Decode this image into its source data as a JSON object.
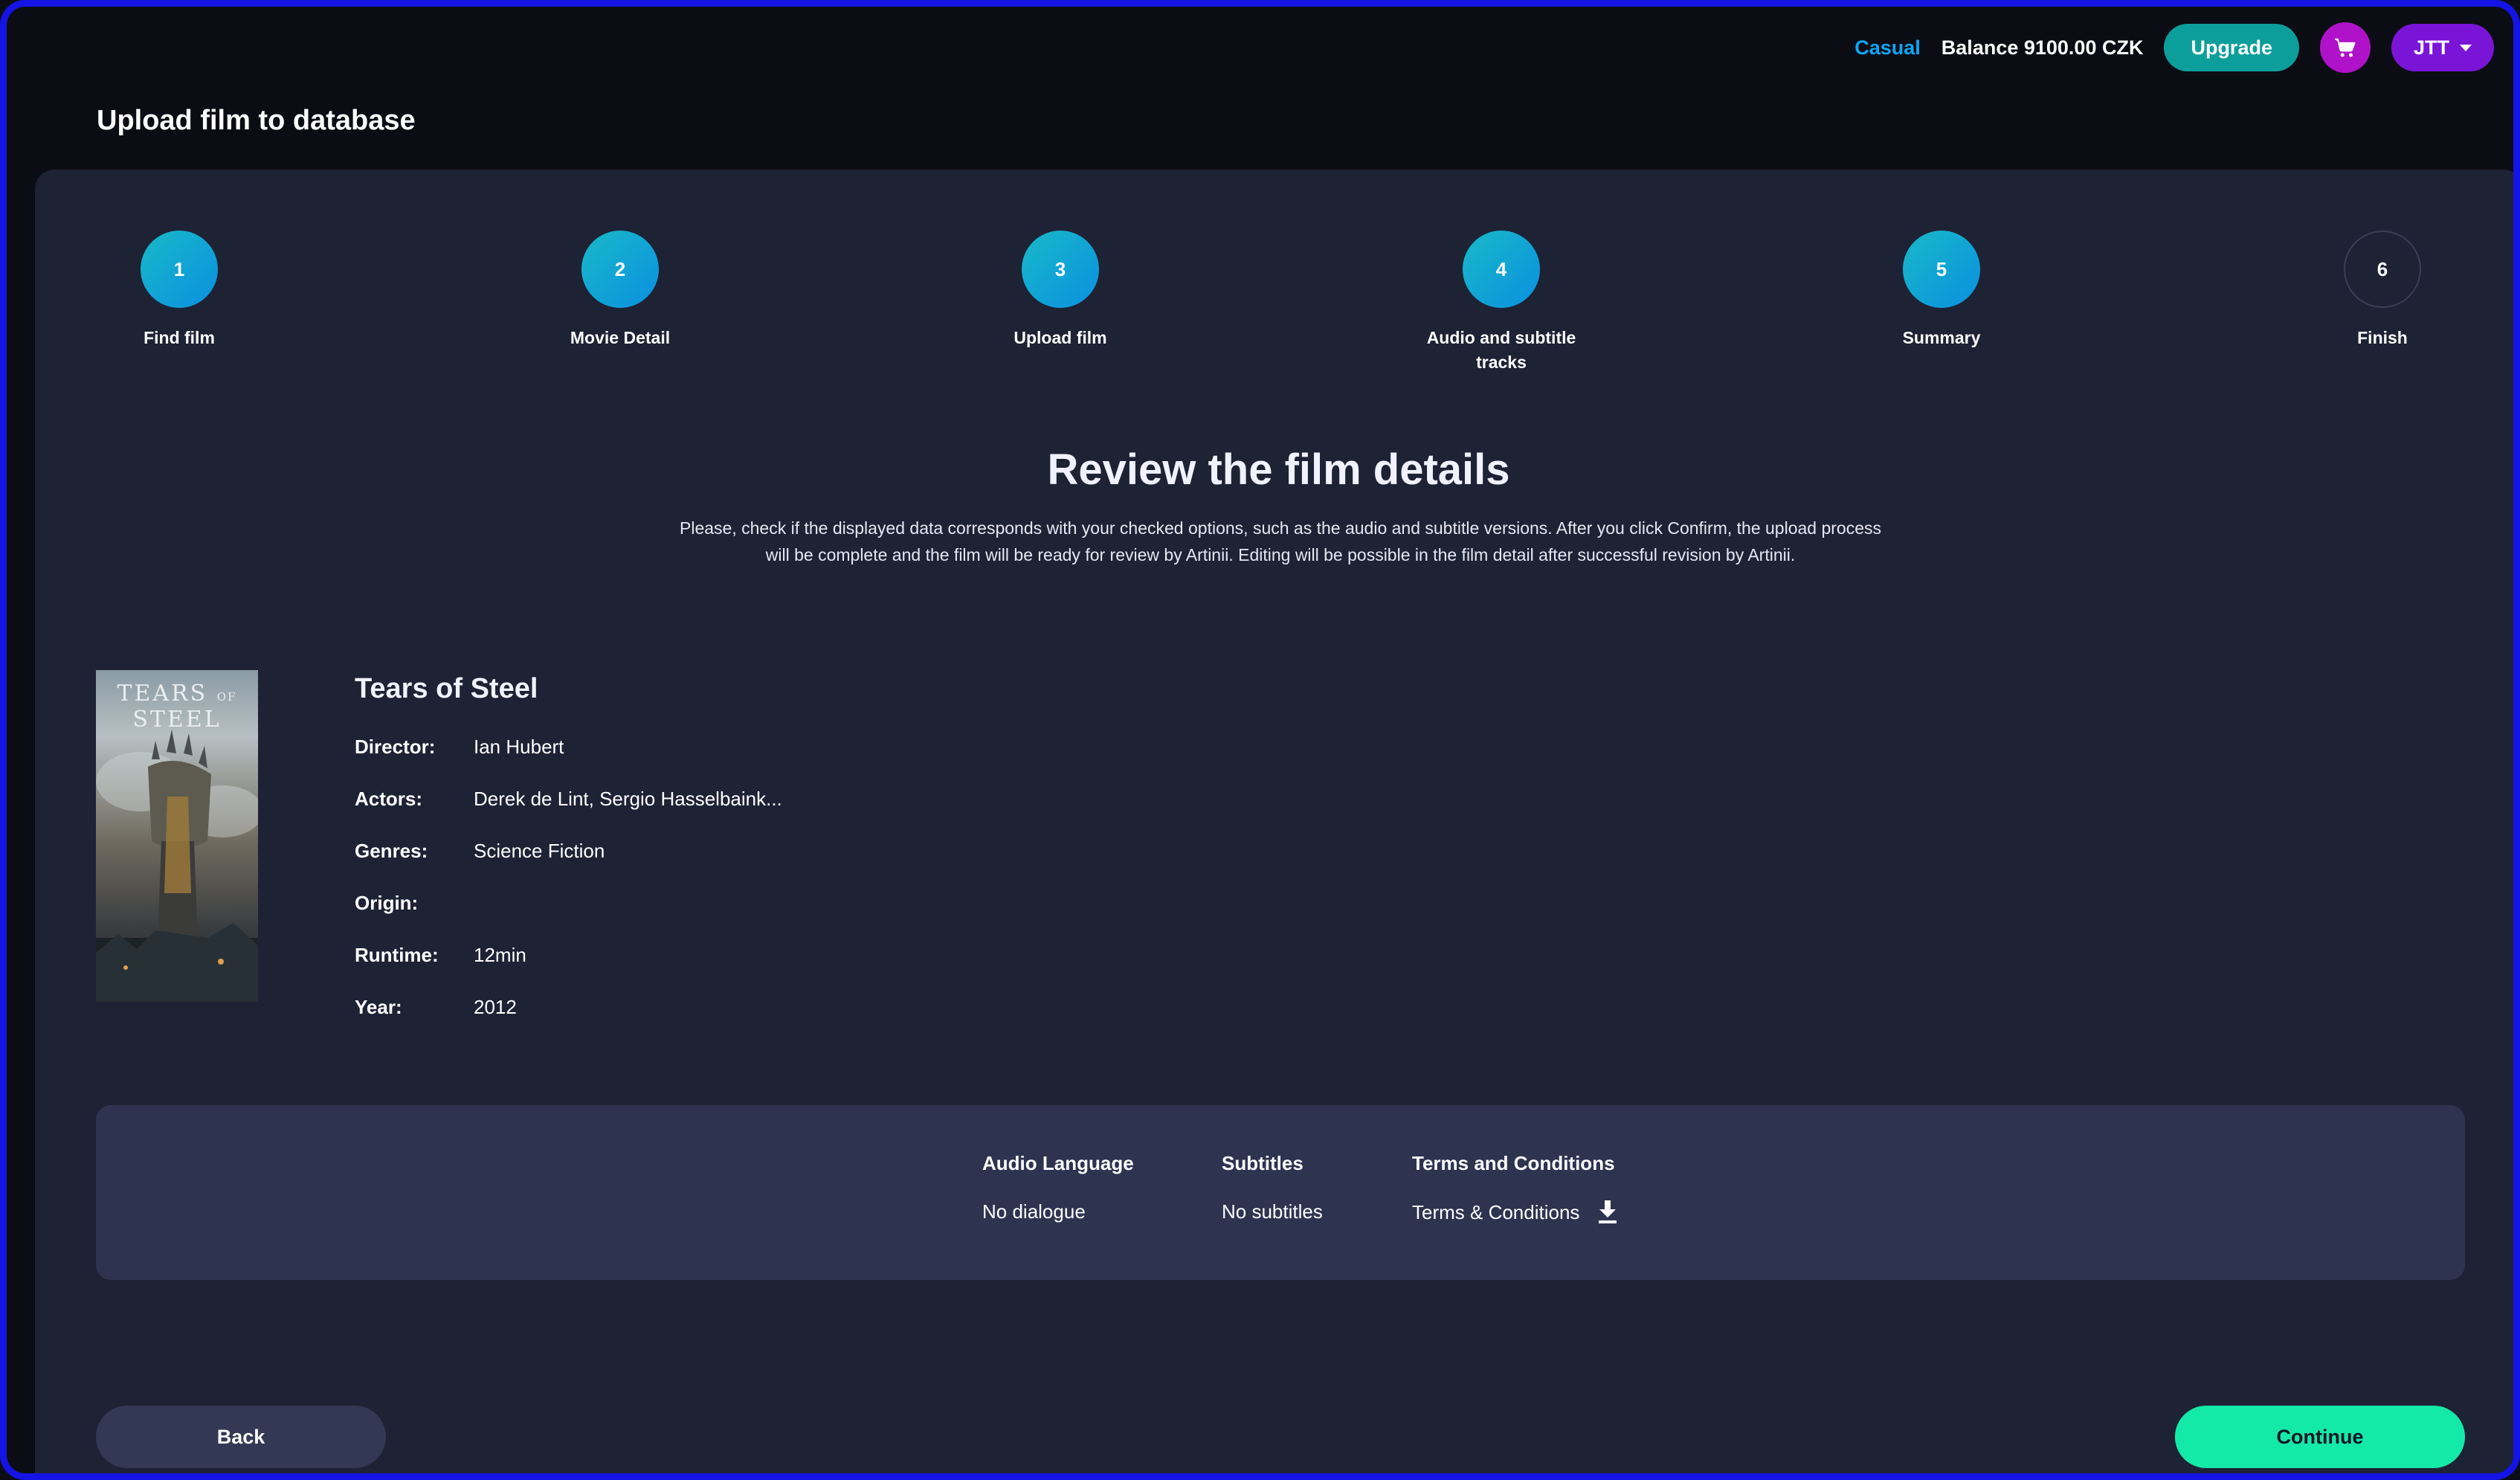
{
  "topbar": {
    "plan": "Casual",
    "balance": "Balance 9100.00 CZK",
    "upgrade_label": "Upgrade",
    "cart_icon": "cart-icon",
    "user_label": "JTT"
  },
  "page": {
    "title": "Upload film to database"
  },
  "steps": [
    {
      "number": "1",
      "label": "Find film",
      "state": "done"
    },
    {
      "number": "2",
      "label": "Movie Detail",
      "state": "done"
    },
    {
      "number": "3",
      "label": "Upload film",
      "state": "done"
    },
    {
      "number": "4",
      "label": "Audio and subtitle tracks",
      "state": "done"
    },
    {
      "number": "5",
      "label": "Summary",
      "state": "current"
    },
    {
      "number": "6",
      "label": "Finish",
      "state": "pending"
    }
  ],
  "review": {
    "title": "Review the film details",
    "description": "Please, check if the displayed data corresponds with your checked options, such as the audio and subtitle versions. After you click Confirm, the upload process will be complete and the film will be ready for review by Artinii. Editing will be possible in the film detail after successful revision by Artinii."
  },
  "film": {
    "poster_text_a": "TEARS",
    "poster_text_b": "OF",
    "poster_text_c": "STEEL",
    "title": "Tears of Steel",
    "director_label": "Director:",
    "director": "Ian Hubert",
    "actors_label": "Actors:",
    "actors": "Derek de Lint, Sergio Hasselbaink...",
    "genres_label": "Genres:",
    "genres": "Science Fiction",
    "origin_label": "Origin:",
    "origin": "",
    "runtime_label": "Runtime:",
    "runtime": "12min",
    "year_label": "Year:",
    "year": "2012"
  },
  "tracks": {
    "audio_header": "Audio Language",
    "audio_value": "No dialogue",
    "subtitles_header": "Subtitles",
    "subtitles_value": "No subtitles",
    "terms_header": "Terms and Conditions",
    "terms_link": "Terms & Conditions"
  },
  "actions": {
    "back_label": "Back",
    "continue_label": "Continue"
  },
  "colors": {
    "accent_teal": "#0c9e9b",
    "continue_green": "#14eaa8",
    "cart_magenta": "#b012c9",
    "user_purple": "#7a15d8",
    "plan_blue": "#0ea5f5"
  }
}
